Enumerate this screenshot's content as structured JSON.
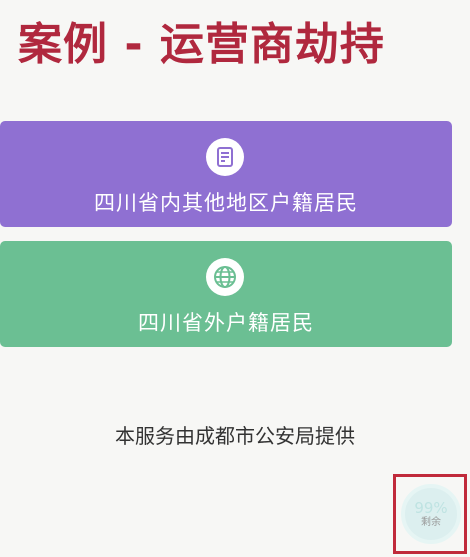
{
  "slide": {
    "title": "案例 - 运营商劫持"
  },
  "cards": [
    {
      "label": "四川省内其他地区户籍居民",
      "icon": "document-icon",
      "color": "#8f70d2"
    },
    {
      "label": "四川省外户籍居民",
      "icon": "globe-icon",
      "color": "#6bbf93"
    }
  ],
  "footer": {
    "note": "本服务由成都市公安局提供"
  },
  "quota": {
    "percent": "99%",
    "label": "剩余"
  },
  "colors": {
    "title": "#b0283e",
    "highlight_border": "#c02a3b"
  }
}
